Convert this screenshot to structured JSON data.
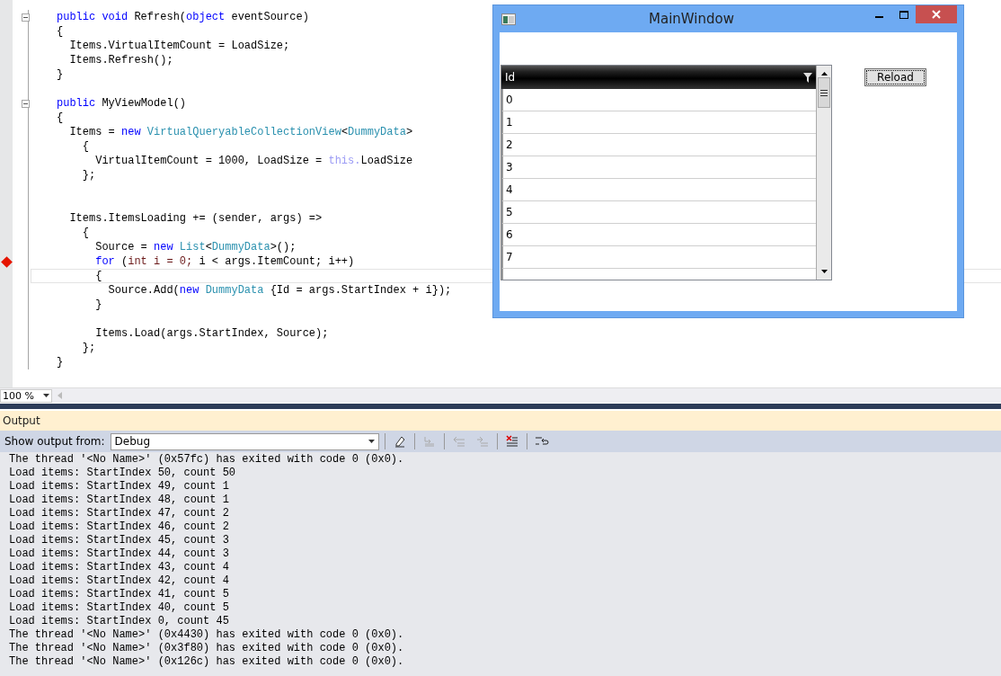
{
  "editor": {
    "lines": [
      {
        "fold": {
          "expanded": true
        },
        "breakpoint": false,
        "current": false,
        "tokens": [
          {
            "kind": "keyword",
            "text": "public void "
          },
          {
            "kind": "plain",
            "text": "Refresh("
          },
          {
            "kind": "keyword",
            "text": "object"
          },
          {
            "kind": "plain",
            "text": " eventSource)"
          }
        ]
      },
      {
        "breakpoint": false,
        "current": false,
        "tokens": [
          {
            "kind": "plain",
            "text": "{"
          }
        ]
      },
      {
        "breakpoint": false,
        "current": false,
        "tokens": [
          {
            "kind": "plain",
            "text": "  Items.VirtualItemCount = LoadSize;"
          }
        ]
      },
      {
        "breakpoint": false,
        "current": false,
        "tokens": [
          {
            "kind": "plain",
            "text": "  Items.Refresh();"
          }
        ]
      },
      {
        "breakpoint": false,
        "current": false,
        "tokens": [
          {
            "kind": "plain",
            "text": "}"
          }
        ]
      },
      {
        "breakpoint": false,
        "current": false
      },
      {
        "fold": {
          "expanded": true
        },
        "breakpoint": false,
        "current": false,
        "tokens": [
          {
            "kind": "keyword",
            "text": "public "
          },
          {
            "kind": "plain",
            "text": "MyViewModel()"
          }
        ]
      },
      {
        "breakpoint": false,
        "current": false,
        "tokens": [
          {
            "kind": "plain",
            "text": "{"
          }
        ]
      },
      {
        "breakpoint": false,
        "current": false,
        "tokens": [
          {
            "kind": "plain",
            "text": "  Items = "
          },
          {
            "kind": "keyword",
            "text": "new "
          },
          {
            "kind": "type",
            "text": "VirtualQueryableCollectionView"
          },
          {
            "kind": "plain",
            "text": "<"
          },
          {
            "kind": "type",
            "text": "DummyData"
          },
          {
            "kind": "plain",
            "text": ">"
          }
        ]
      },
      {
        "breakpoint": false,
        "current": false,
        "tokens": [
          {
            "kind": "plain",
            "text": "    {"
          }
        ]
      },
      {
        "breakpoint": false,
        "current": false,
        "tokens": [
          {
            "kind": "plain",
            "text": "      VirtualItemCount = 1000, LoadSize = "
          },
          {
            "kind": "faded",
            "text": "this."
          },
          {
            "kind": "plain",
            "text": "LoadSize"
          }
        ]
      },
      {
        "breakpoint": false,
        "current": false,
        "tokens": [
          {
            "kind": "plain",
            "text": "    };"
          }
        ]
      },
      {
        "breakpoint": false,
        "current": false
      },
      {
        "breakpoint": false,
        "current": false
      },
      {
        "breakpoint": false,
        "current": false,
        "tokens": [
          {
            "kind": "plain",
            "text": "  Items.ItemsLoading += (sender, args) =>"
          }
        ]
      },
      {
        "breakpoint": false,
        "current": false,
        "tokens": [
          {
            "kind": "plain",
            "text": "    {"
          }
        ]
      },
      {
        "breakpoint": false,
        "current": false,
        "tokens": [
          {
            "kind": "plain",
            "text": "      Source = "
          },
          {
            "kind": "keyword",
            "text": "new "
          },
          {
            "kind": "type",
            "text": "List"
          },
          {
            "kind": "plain",
            "text": "<"
          },
          {
            "kind": "type",
            "text": "DummyData"
          },
          {
            "kind": "plain",
            "text": ">();"
          }
        ]
      },
      {
        "breakpoint": true,
        "current": false,
        "tokens": [
          {
            "kind": "keyword",
            "text": "      for"
          },
          {
            "kind": "plain",
            "text": " ("
          },
          {
            "kind": "reference",
            "text": "int i = 0;"
          },
          {
            "kind": "plain",
            "text": " i < args.ItemCount; i++)"
          }
        ]
      },
      {
        "breakpoint": false,
        "current": true,
        "tokens": [
          {
            "kind": "plain",
            "text": "      {"
          }
        ]
      },
      {
        "breakpoint": false,
        "current": false,
        "tokens": [
          {
            "kind": "plain",
            "text": "        Source.Add("
          },
          {
            "kind": "keyword",
            "text": "new "
          },
          {
            "kind": "type",
            "text": "DummyData"
          },
          {
            "kind": "plain",
            "text": " {Id = args.StartIndex + i});"
          }
        ]
      },
      {
        "breakpoint": false,
        "current": false,
        "tokens": [
          {
            "kind": "plain",
            "text": "      }"
          }
        ]
      },
      {
        "breakpoint": false,
        "current": false
      },
      {
        "breakpoint": false,
        "current": false,
        "tokens": [
          {
            "kind": "plain",
            "text": "      Items.Load(args.StartIndex, Source);"
          }
        ]
      },
      {
        "breakpoint": false,
        "current": false,
        "tokens": [
          {
            "kind": "plain",
            "text": "    };"
          }
        ]
      },
      {
        "breakpoint": false,
        "current": false,
        "tokens": [
          {
            "kind": "plain",
            "text": "}"
          }
        ]
      }
    ],
    "zoom": "100 %"
  },
  "app_window": {
    "title": "MainWindow",
    "grid": {
      "column": "Id",
      "rows": [
        "0",
        "1",
        "2",
        "3",
        "4",
        "5",
        "6",
        "7"
      ]
    },
    "reload_button": "Reload"
  },
  "output": {
    "title": "Output",
    "source_label": "Show output from:",
    "source": "Debug",
    "lines": [
      "The thread '<No Name>' (0x57fc) has exited with code 0 (0x0).",
      "Load items: StartIndex 50, count 50",
      "Load items: StartIndex 49, count 1",
      "Load items: StartIndex 48, count 1",
      "Load items: StartIndex 47, count 2",
      "Load items: StartIndex 46, count 2",
      "Load items: StartIndex 45, count 3",
      "Load items: StartIndex 44, count 3",
      "Load items: StartIndex 43, count 4",
      "Load items: StartIndex 42, count 4",
      "Load items: StartIndex 41, count 5",
      "Load items: StartIndex 40, count 5",
      "Load items: StartIndex 0, count 45",
      "The thread '<No Name>' (0x4430) has exited with code 0 (0x0).",
      "The thread '<No Name>' (0x3f80) has exited with code 0 (0x0).",
      "The thread '<No Name>' (0x126c) has exited with code 0 (0x0)."
    ]
  }
}
